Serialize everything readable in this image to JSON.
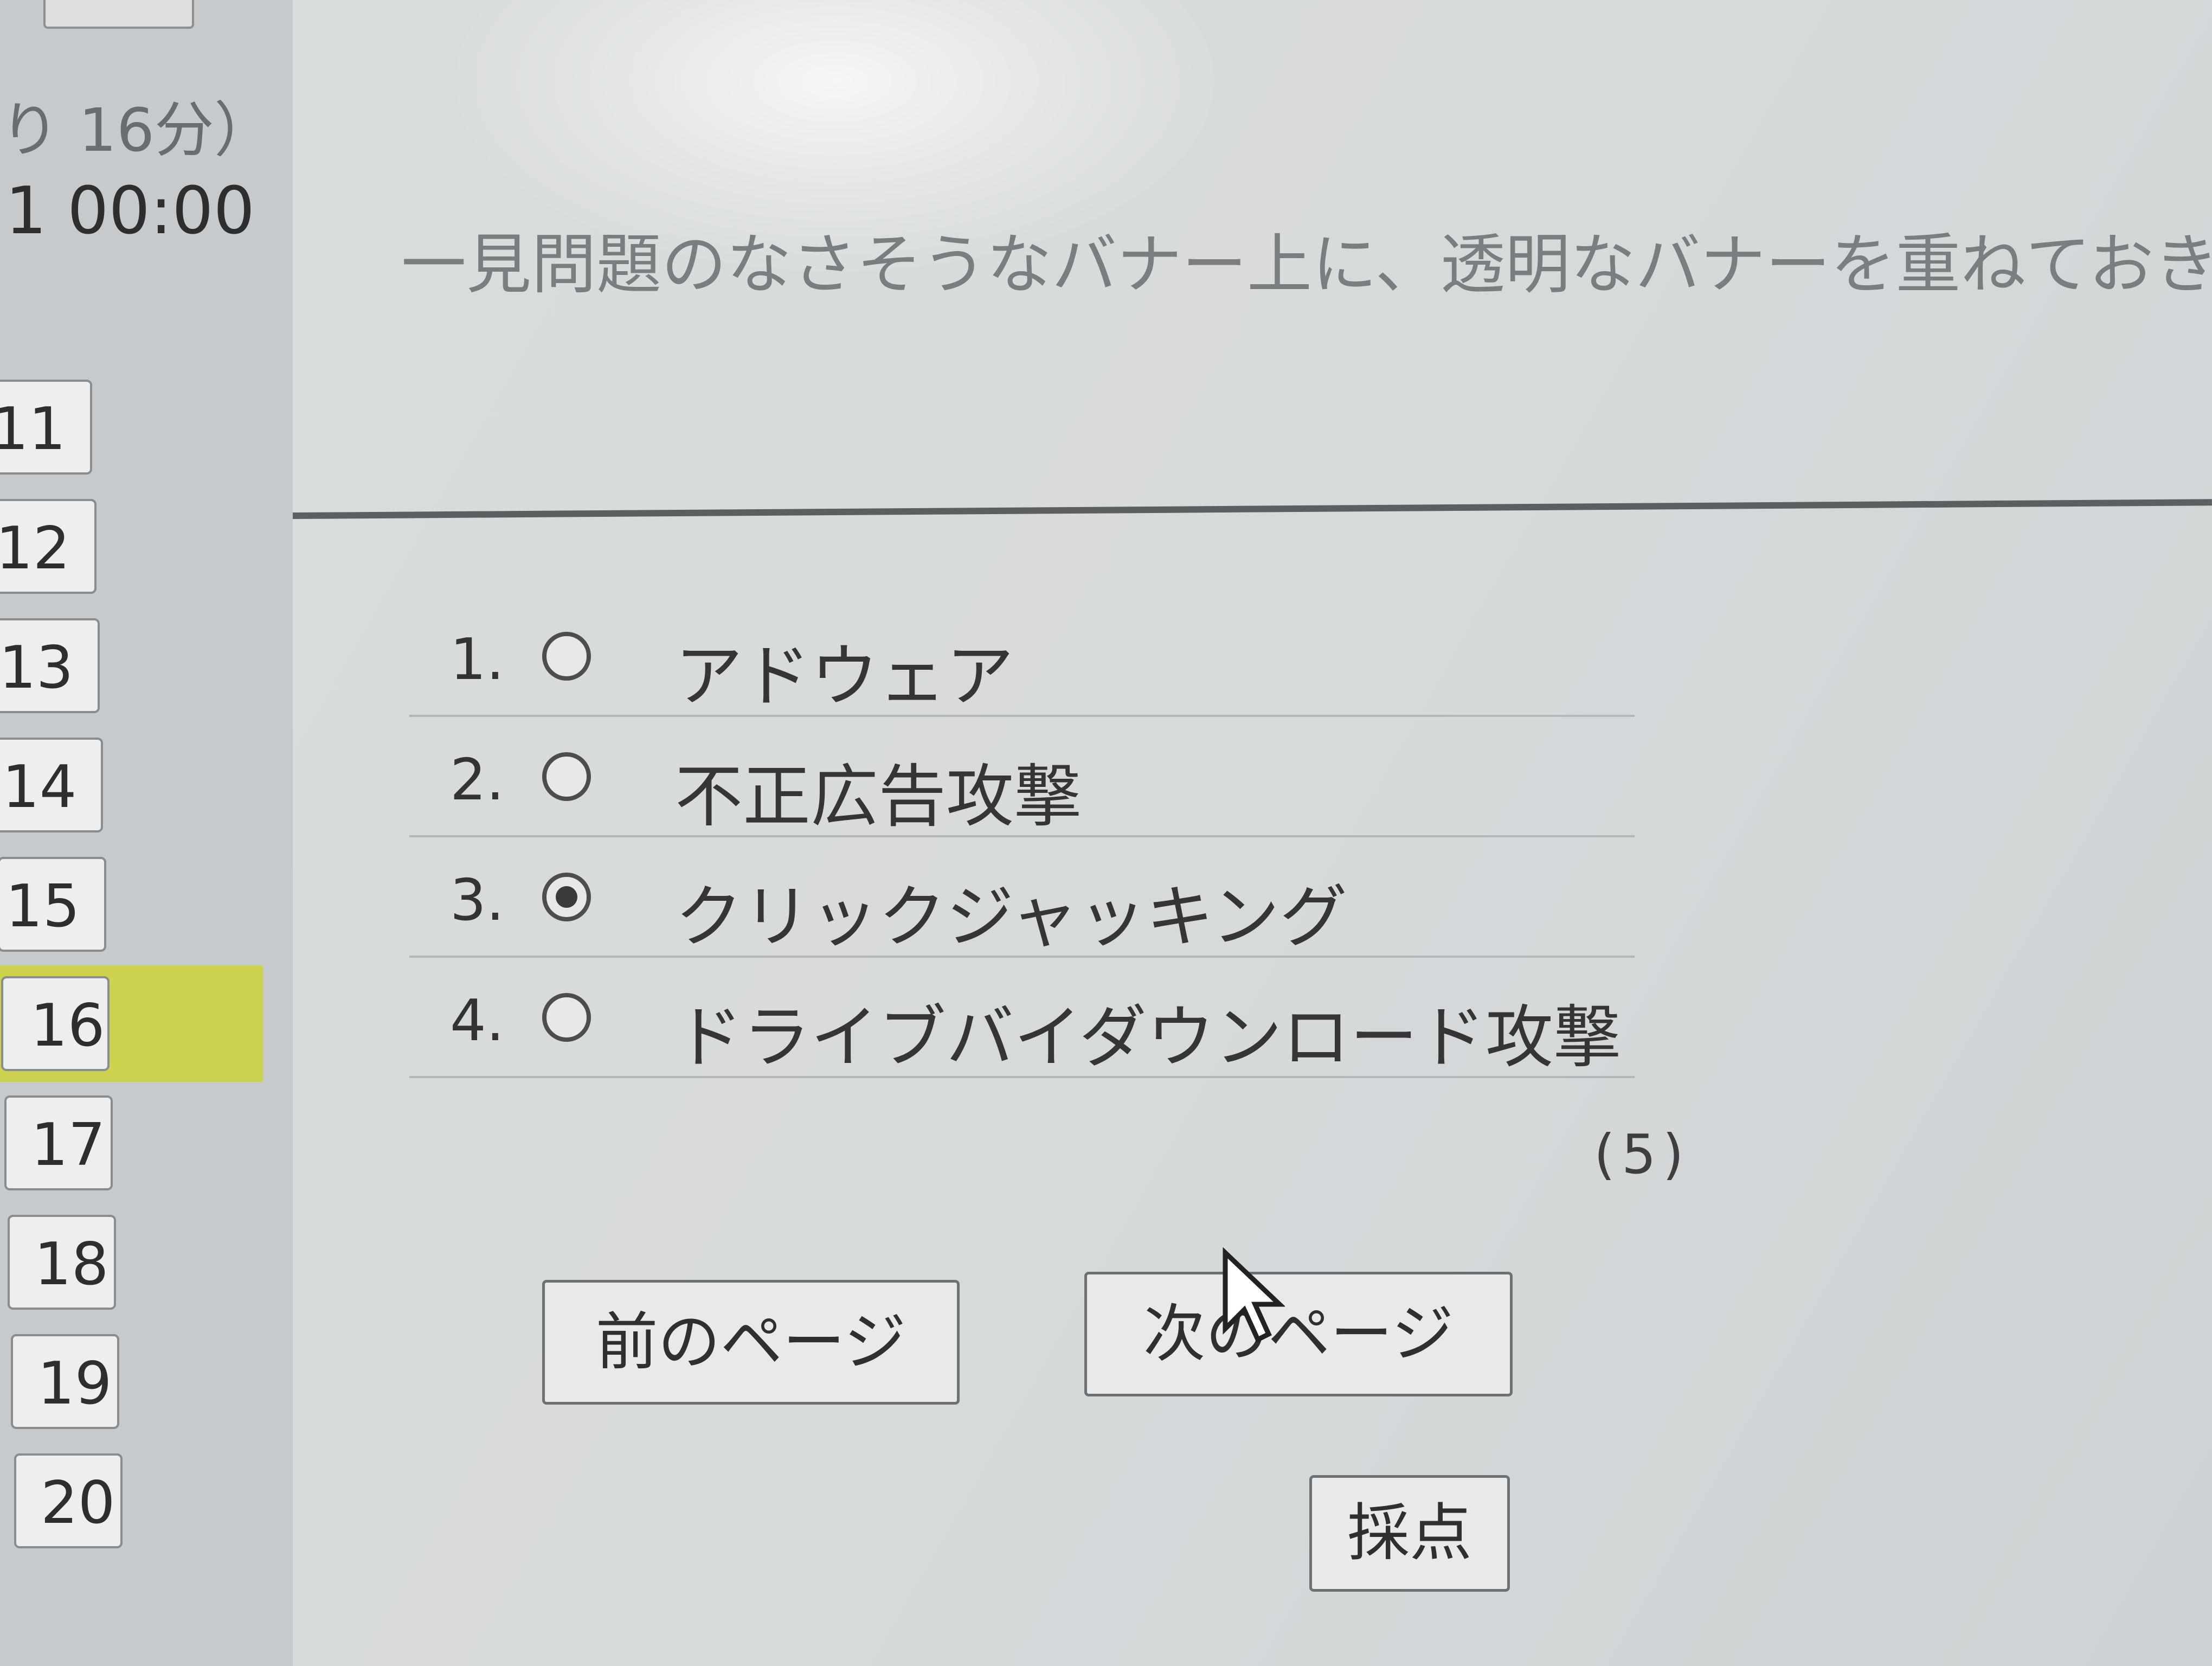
{
  "sidebar": {
    "remaining_text": "り 16分）",
    "clock_text": "1 00:00",
    "question_buttons": [
      "11",
      "12",
      "13",
      "14",
      "15",
      "16",
      "17",
      "18",
      "19",
      "20"
    ],
    "current_question": "16",
    "highlight_color": "#cdd34f"
  },
  "question": {
    "text": "一見問題のなさそうなバナー上に、透明なバナーを重ねておき、"
  },
  "options": [
    {
      "number": "1.",
      "label": "アドウェア",
      "selected": false
    },
    {
      "number": "2.",
      "label": "不正広告攻撃",
      "selected": false
    },
    {
      "number": "3.",
      "label": "クリックジャッキング",
      "selected": true
    },
    {
      "number": "4.",
      "label": "ドライブバイダウンロード攻撃",
      "selected": false
    }
  ],
  "points": "(5)",
  "nav": {
    "prev_label": "前のページ",
    "next_label": "次のページ",
    "grade_label": "採点"
  }
}
